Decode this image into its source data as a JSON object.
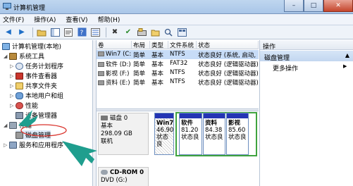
{
  "window": {
    "title": "计算机管理"
  },
  "menu": [
    "文件(F)",
    "操作(A)",
    "查看(V)",
    "帮助(H)"
  ],
  "tree": {
    "root": "计算机管理(本地)",
    "system_tools": "系统工具",
    "task_scheduler": "任务计划程序",
    "event_viewer": "事件查看器",
    "shared_folders": "共享文件夹",
    "local_users": "本地用户和组",
    "performance": "性能",
    "device_manager": "设备管理器",
    "storage": "存储",
    "disk_management": "磁盘管理",
    "services": "服务和应用程序"
  },
  "volumes": {
    "columns": [
      "卷",
      "布局",
      "类型",
      "文件系统",
      "状态"
    ],
    "rows": [
      {
        "vol": "Win7 (C:)",
        "layout": "简单",
        "type": "基本",
        "fs": "NTFS",
        "status": "状态良好 (系统, 启动,"
      },
      {
        "vol": "软件 (D:)",
        "layout": "简单",
        "type": "基本",
        "fs": "FAT32",
        "status": "状态良好 (逻辑驱动器)"
      },
      {
        "vol": "影视 (F:)",
        "layout": "简单",
        "type": "基本",
        "fs": "NTFS",
        "status": "状态良好 (逻辑驱动器)"
      },
      {
        "vol": "资料 (E:)",
        "layout": "简单",
        "type": "基本",
        "fs": "NTFS",
        "status": "状态良好 (逻辑驱动器)"
      }
    ]
  },
  "disk0": {
    "name": "磁盘 0",
    "type": "基本",
    "size": "298.09 GB",
    "status": "联机",
    "partitions": [
      {
        "label": "Win7",
        "size": "46.90",
        "status": "状态良"
      },
      {
        "label": "软件",
        "size": "81.20",
        "status": "状态良"
      },
      {
        "label": "资料",
        "size": "84.38",
        "status": "状态良"
      },
      {
        "label": "影视",
        "size": "85.60",
        "status": "状态良"
      }
    ]
  },
  "cdrom": {
    "name": "CD-ROM 0",
    "type": "DVD (G:)"
  },
  "actions": {
    "header": "操作",
    "section": "磁盘管理",
    "more": "更多操作"
  },
  "colors": {
    "partition_cap": "#2434b4",
    "extended_border": "#3fa33f",
    "callout": "#1f9e8e"
  }
}
